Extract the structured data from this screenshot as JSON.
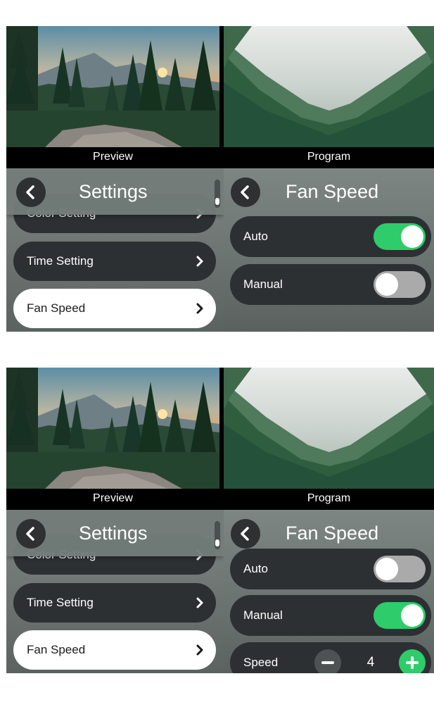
{
  "screens": [
    {
      "preview_label": "Preview",
      "program_label": "Program",
      "settings": {
        "title": "Settings",
        "items": [
          {
            "label": "Color Setting"
          },
          {
            "label": "Time Setting"
          },
          {
            "label": "Fan Speed",
            "active": true
          }
        ]
      },
      "fan": {
        "title": "Fan Speed",
        "auto_label": "Auto",
        "auto_on": true,
        "manual_label": "Manual",
        "manual_on": false
      }
    },
    {
      "preview_label": "Preview",
      "program_label": "Program",
      "settings": {
        "title": "Settings",
        "items": [
          {
            "label": "Color Setting"
          },
          {
            "label": "Time Setting"
          },
          {
            "label": "Fan Speed",
            "active": true
          }
        ]
      },
      "fan": {
        "title": "Fan Speed",
        "auto_label": "Auto",
        "auto_on": false,
        "manual_label": "Manual",
        "manual_on": true,
        "speed_label": "Speed",
        "speed_value": "4"
      }
    }
  ],
  "colors": {
    "toggle_on": "#2ecc6a",
    "toggle_off": "#a9aaa9",
    "pill_dark": "#2d3032",
    "pill_active": "#ffffff"
  },
  "icons": [
    "back-chevron-icon",
    "chevron-right-icon",
    "minus-icon",
    "plus-icon"
  ]
}
